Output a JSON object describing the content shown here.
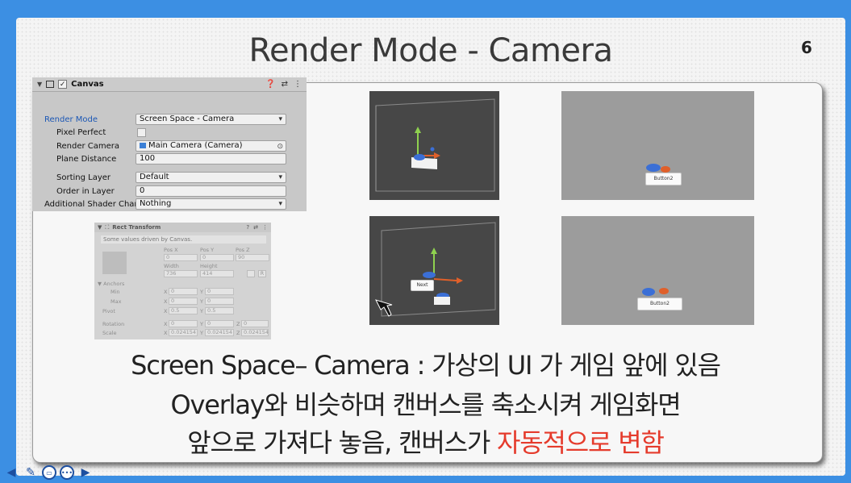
{
  "slide": {
    "title": "Render Mode - Camera",
    "page_number": "6"
  },
  "canvas_inspector": {
    "component_title": "Canvas",
    "rows": {
      "render_mode": {
        "label": "Render Mode",
        "value": "Screen Space - Camera"
      },
      "pixel_perfect": {
        "label": "Pixel Perfect"
      },
      "render_camera": {
        "label": "Render Camera",
        "value": "Main Camera (Camera)"
      },
      "plane_distance": {
        "label": "Plane Distance",
        "value": "100"
      },
      "sorting_layer": {
        "label": "Sorting Layer",
        "value": "Default"
      },
      "order_in_layer": {
        "label": "Order in Layer",
        "value": "0"
      },
      "additional_shader": {
        "label": "Additional Shader Chan",
        "value": "Nothing"
      }
    }
  },
  "rect_transform": {
    "title": "Rect Transform",
    "note": "Some values driven by Canvas.",
    "pos_x_label": "Pos X",
    "pos_y_label": "Pos Y",
    "pos_z_label": "Pos Z",
    "pos_x": "0",
    "pos_y": "0",
    "pos_z": "90",
    "width_label": "Width",
    "height_label": "Height",
    "width": "736",
    "height": "414",
    "anchors_label": "Anchors",
    "min_label": "Min",
    "max_label": "Max",
    "pivot_label": "Pivot",
    "x_label": "X",
    "y_label": "Y",
    "z_label": "Z",
    "min_x": "0",
    "min_y": "0",
    "max_x": "0",
    "max_y": "0",
    "pivot_x": "0.5",
    "pivot_y": "0.5",
    "rotation_label": "Rotation",
    "scale_label": "Scale",
    "rot_x": "0",
    "rot_y": "0",
    "rot_z": "0",
    "scale_x": "0.024154",
    "scale_y": "0.024154",
    "scale_z": "0.024154",
    "r_button": "R"
  },
  "game_views": {
    "top_button": "Button2",
    "bottom_button": "Button2"
  },
  "scene_views": {
    "bottom_button": "Next"
  },
  "caption": {
    "line1": "Screen Space– Camera : 가상의 UI 가 게임 앞에 있음",
    "line2": "Overlay와 비슷하며 캔버스를 축소시켜 게임화면",
    "line3_prefix": "앞으로 가져다 놓음, 캔버스가 ",
    "line3_highlight": "자동적으로 변함"
  },
  "colors": {
    "background": "#3c8fe3",
    "highlight": "#e53b2c",
    "inspector_label": "#1b57b5"
  }
}
